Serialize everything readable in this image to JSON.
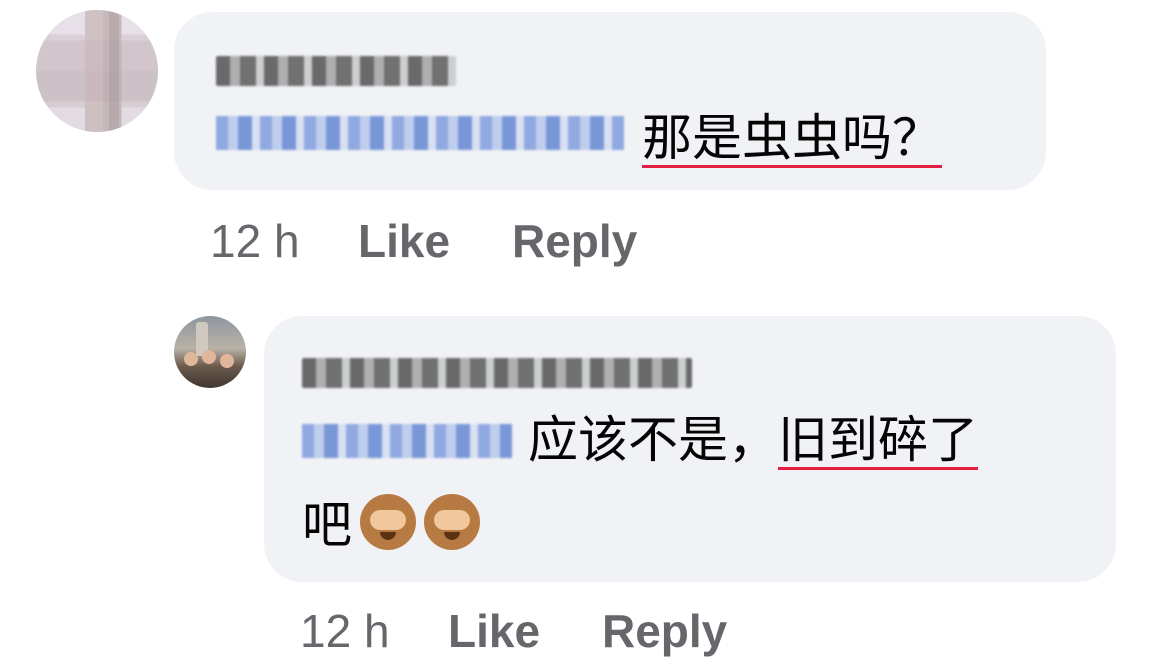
{
  "comments": [
    {
      "text": "那是虫虫吗？",
      "time": "12 h",
      "like_label": "Like",
      "reply_label": "Reply"
    },
    {
      "text_part_1": "应该不是，",
      "text_part_2_underlined": "旧到碎了",
      "text_line_2": "吧",
      "emoji": [
        "see-no-evil-monkey",
        "see-no-evil-monkey"
      ],
      "time": "12 h",
      "like_label": "Like",
      "reply_label": "Reply"
    }
  ],
  "colors": {
    "bubble": "#f0f2f5",
    "meta_text": "#65676b",
    "spellcheck_underline": "#e41e3f"
  }
}
